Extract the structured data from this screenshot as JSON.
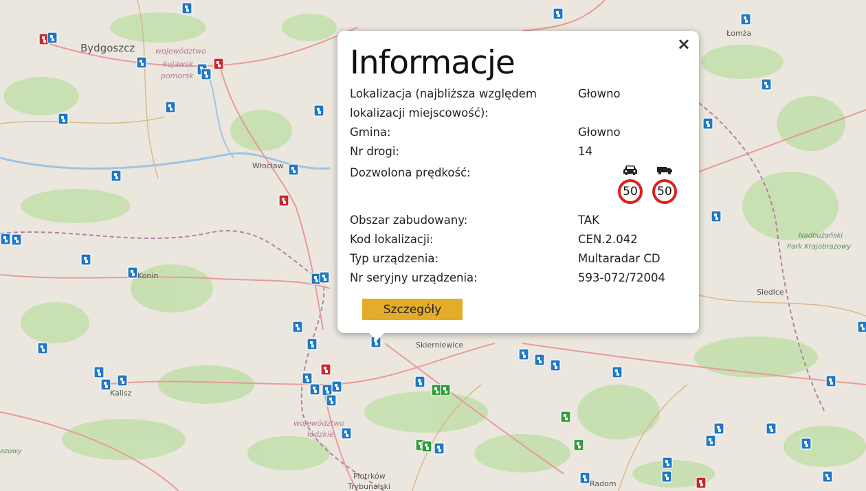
{
  "map": {
    "labels": [
      {
        "text": "Bydgoszcz",
        "kind": "city"
      },
      {
        "text": "województwo",
        "kind": "admin"
      },
      {
        "text": "kujawsk",
        "kind": "admin"
      },
      {
        "text": "pomorsk",
        "kind": "admin"
      },
      {
        "text": "Włocław",
        "kind": "city"
      },
      {
        "text": "Łomża",
        "kind": "city"
      },
      {
        "text": "Konin",
        "kind": "city"
      },
      {
        "text": "Kalisz",
        "kind": "city"
      },
      {
        "text": "województwo",
        "kind": "admin"
      },
      {
        "text": "łódzkie",
        "kind": "admin"
      },
      {
        "text": "Skierniewice",
        "kind": "city"
      },
      {
        "text": "Piotrków",
        "kind": "city"
      },
      {
        "text": "Trybunalski",
        "kind": "city"
      },
      {
        "text": "Siedlce",
        "kind": "city"
      },
      {
        "text": "Nadbużański",
        "kind": "park"
      },
      {
        "text": "Park Krajobrazowy",
        "kind": "park"
      },
      {
        "text": "Radom",
        "kind": "city"
      },
      {
        "text": "azowy",
        "kind": "park"
      }
    ],
    "marker_colors": {
      "blue": "#1f78c8",
      "red": "#d0262d",
      "green": "#2f9e3a"
    }
  },
  "popup": {
    "title": "Informacje",
    "close_symbol": "×",
    "rows": [
      {
        "label": "Lokalizacja (najbliższa względem lokalizacji miejscowość):",
        "value": "Głowno"
      },
      {
        "label": "Gmina:",
        "value": "Głowno"
      },
      {
        "label": "Nr drogi:",
        "value": "14"
      }
    ],
    "speed": {
      "label": "Dozwolona prędkość:",
      "car": {
        "icon": "car-icon",
        "limit": "50"
      },
      "truck": {
        "icon": "truck-icon",
        "limit": "50"
      }
    },
    "rows2": [
      {
        "label": "Obszar zabudowany:",
        "value": "TAK"
      },
      {
        "label": "Kod lokalizacji:",
        "value": "CEN.2.042"
      },
      {
        "label": "Typ urządzenia:",
        "value": "Multaradar CD"
      },
      {
        "label": "Nr seryjny urządzenia:",
        "value": "593-072/72004"
      }
    ],
    "details_button": "Szczegóły"
  }
}
